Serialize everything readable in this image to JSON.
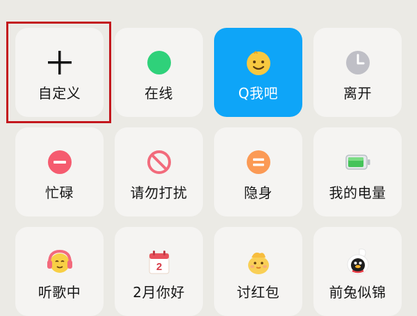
{
  "colors": {
    "background": "#ebeae5",
    "tile": "#f5f4f2",
    "active_tile": "#0ea5f8",
    "highlight_border": "#c3161c"
  },
  "status_tiles": [
    {
      "label": "自定义",
      "icon": "plus-icon",
      "selected": false
    },
    {
      "label": "在线",
      "icon": "green-dot-icon",
      "selected": false
    },
    {
      "label": "Q我吧",
      "icon": "smiley-face-icon",
      "selected": true
    },
    {
      "label": "离开",
      "icon": "clock-icon",
      "selected": false
    },
    {
      "label": "忙碌",
      "icon": "minus-circle-icon",
      "selected": false
    },
    {
      "label": "请勿打扰",
      "icon": "prohibited-icon",
      "selected": false
    },
    {
      "label": "隐身",
      "icon": "equals-circle-icon",
      "selected": false
    },
    {
      "label": "我的电量",
      "icon": "battery-icon",
      "selected": false
    },
    {
      "label": "听歌中",
      "icon": "headphones-face-icon",
      "selected": false
    },
    {
      "label": "2月你好",
      "icon": "calendar-2-icon",
      "selected": false
    },
    {
      "label": "讨红包",
      "icon": "chick-icon",
      "selected": false
    },
    {
      "label": "前兔似锦",
      "icon": "penguin-rabbit-icon",
      "selected": false
    }
  ],
  "calendar_icon_text": "2"
}
